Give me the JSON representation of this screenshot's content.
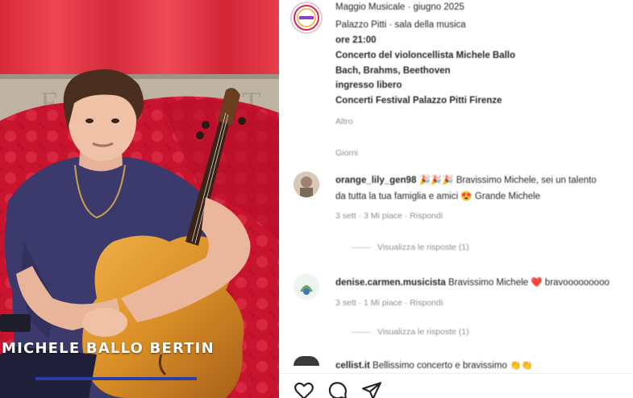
{
  "video": {
    "overlay_name": "MICHELE BALLO BERTIN"
  },
  "post": {
    "username": "maggiomusicale",
    "date_line": "Maggio Musicale · giugno 2025",
    "caption_lines": [
      {
        "text": "Palazzo Pitti · sala della musica",
        "bold": false
      },
      {
        "text": "ore 21:00",
        "bold": true
      },
      {
        "text": "Concerto del violoncellista Michele Ballo",
        "bold": true
      },
      {
        "text": "Bach, Brahms, Beethoven",
        "bold": true
      },
      {
        "text": "ingresso libero",
        "bold": true
      },
      {
        "text": "Concerti Festival Palazzo Pitti Firenze",
        "bold": true
      }
    ],
    "more_label": "Altro",
    "hashtag_label": "Giorni"
  },
  "comments": [
    {
      "username": "orange_lily_gen98",
      "emojis": "🎉🎉🎉",
      "text_line1": "Bravissimo Michele, sei un talento",
      "text_line2": "da tutta la tua famiglia e amici",
      "emoji2": "😍",
      "text_tail": "Grande Michele",
      "meta": "3 sett · 3 Mi piace · Rispondi",
      "replies_label": "Visualizza le risposte (1)"
    },
    {
      "username": "denise.carmen.musicista",
      "text_line1": "Bravissimo Michele",
      "emoji": "❤️",
      "text_tail": "bravooooooooo",
      "meta": "3 sett · 1 Mi piace · Rispondi",
      "replies_label": "Visualizza le risposte (1)"
    },
    {
      "username": "cellist.it",
      "text_line1": "Bellissimo concerto e bravissimo",
      "emoji": "👏👏",
      "meta": "",
      "replies_label": ""
    }
  ],
  "actions": {
    "like_icon": "heart-icon",
    "comment_icon": "comment-icon",
    "share_icon": "send-icon"
  },
  "colors": {
    "curtain": "#e0323c",
    "sofa": "#c8102e",
    "shirt": "#3d3a6a",
    "name_bar": "#2a3ea8",
    "muted": "#8e8e8e"
  }
}
